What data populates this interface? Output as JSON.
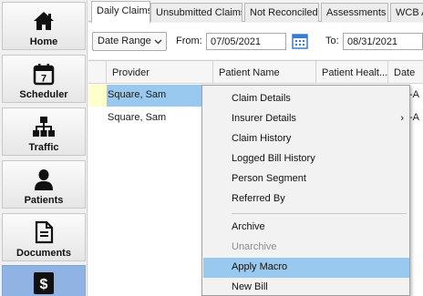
{
  "nav": [
    {
      "label": "Home",
      "icon": "home-icon"
    },
    {
      "label": "Scheduler",
      "icon": "calendar-icon",
      "day": "7"
    },
    {
      "label": "Traffic",
      "icon": "org-chart-icon"
    },
    {
      "label": "Patients",
      "icon": "person-icon"
    },
    {
      "label": "Documents",
      "icon": "document-icon"
    },
    {
      "label": "",
      "icon": "dollar-icon",
      "symbol": "$",
      "active": true
    }
  ],
  "tabs": [
    "Daily Claims",
    "Unsubmitted Claims",
    "Not Reconciled",
    "Assessments",
    "WCB A"
  ],
  "active_tab": "Daily Claims",
  "filters": {
    "range": "Date Range",
    "from_label": "From:",
    "from_value": "07/05/2021",
    "to_label": "To:",
    "to_value": "08/31/2021"
  },
  "grid": {
    "columns": [
      "Provider",
      "Patient Name",
      "Patient Healt...",
      "Date"
    ],
    "rows": [
      {
        "provider": "Square, Sam",
        "tail": "-A",
        "selected": true
      },
      {
        "provider": "Square, Sam",
        "tail": "-A",
        "selected": false
      }
    ]
  },
  "menu": {
    "items": [
      {
        "label": "Claim Details"
      },
      {
        "label": "Insurer Details",
        "submenu": "›"
      },
      {
        "label": "Claim History"
      },
      {
        "label": "Logged Bill History"
      },
      {
        "label": "Person Segment"
      },
      {
        "label": "Referred By"
      },
      {
        "label": "Archive"
      },
      {
        "label": "Unarchive",
        "disabled": true
      },
      {
        "label": "Apply Macro",
        "hover": true
      },
      {
        "label": "New Bill"
      }
    ]
  },
  "colors": {
    "selection": "#99c9ef",
    "active_nav": "#8fb4e4",
    "calendar_blue": "#3a7bd5"
  }
}
